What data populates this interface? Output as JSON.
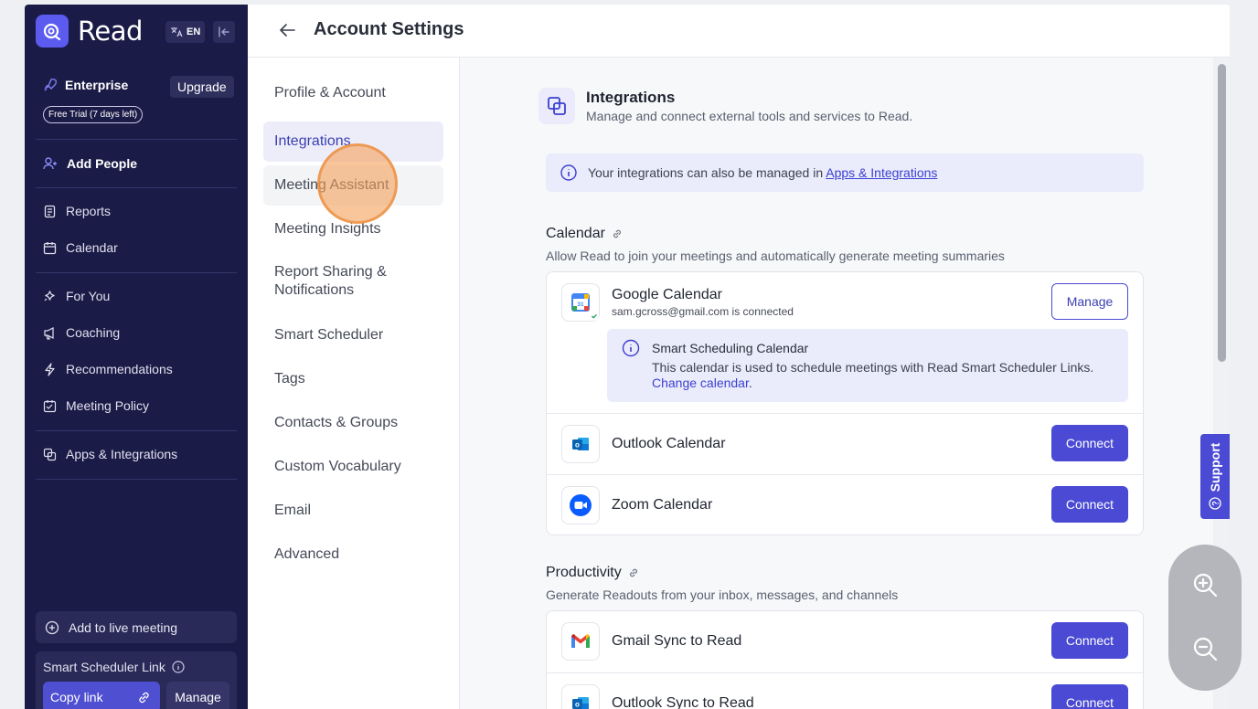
{
  "app": {
    "name": "Read",
    "language": "EN"
  },
  "sidebar": {
    "plan": "Enterprise",
    "upgrade_label": "Upgrade",
    "trial_badge": "Free Trial (7 days left)",
    "add_people": "Add People",
    "items": [
      {
        "label": "Reports",
        "icon": "report-icon"
      },
      {
        "label": "Calendar",
        "icon": "calendar-icon"
      },
      {
        "label": "For You",
        "icon": "sparkle-icon"
      },
      {
        "label": "Coaching",
        "icon": "megaphone-icon"
      },
      {
        "label": "Recommendations",
        "icon": "bolt-icon"
      },
      {
        "label": "Meeting Policy",
        "icon": "policy-icon"
      },
      {
        "label": "Apps & Integrations",
        "icon": "apps-icon"
      }
    ],
    "add_live": "Add to live meeting",
    "smart_scheduler": "Smart Scheduler Link",
    "copy_link": "Copy link",
    "manage": "Manage"
  },
  "header": {
    "title": "Account Settings"
  },
  "settings_nav": {
    "items": [
      "Profile & Account",
      "Integrations",
      "Meeting Assistant",
      "Meeting Insights",
      "Report Sharing & Notifications",
      "Smart Scheduler",
      "Tags",
      "Contacts & Groups",
      "Custom Vocabulary",
      "Email",
      "Advanced"
    ],
    "active": "Integrations"
  },
  "content": {
    "title": "Integrations",
    "subtitle": "Manage and connect external tools and services to Read.",
    "banner_text": "Your integrations can also be managed in ",
    "banner_link": "Apps & Integrations",
    "calendar": {
      "title": "Calendar",
      "subtitle": "Allow Read to join your meetings and automatically generate meeting summaries",
      "google": {
        "name": "Google Calendar",
        "status": "sam.gcross@gmail.com is connected",
        "button": "Manage"
      },
      "smart_note": {
        "title": "Smart Scheduling Calendar",
        "desc": "This calendar is used to schedule meetings with Read Smart Scheduler Links. ",
        "link": "Change calendar",
        "tail": "."
      },
      "outlook": {
        "name": "Outlook Calendar",
        "button": "Connect"
      },
      "zoom": {
        "name": "Zoom Calendar",
        "button": "Connect"
      }
    },
    "productivity": {
      "title": "Productivity",
      "subtitle": "Generate Readouts from your inbox, messages, and channels",
      "gmail": {
        "name": "Gmail Sync to Read",
        "button": "Connect"
      },
      "outlook": {
        "name": "Outlook Sync to Read",
        "button": "Connect"
      }
    }
  },
  "support_label": "Support",
  "colors": {
    "sidebar": "#1b1b47",
    "accent": "#4a4ad4",
    "logo": "#5b5bf0"
  }
}
